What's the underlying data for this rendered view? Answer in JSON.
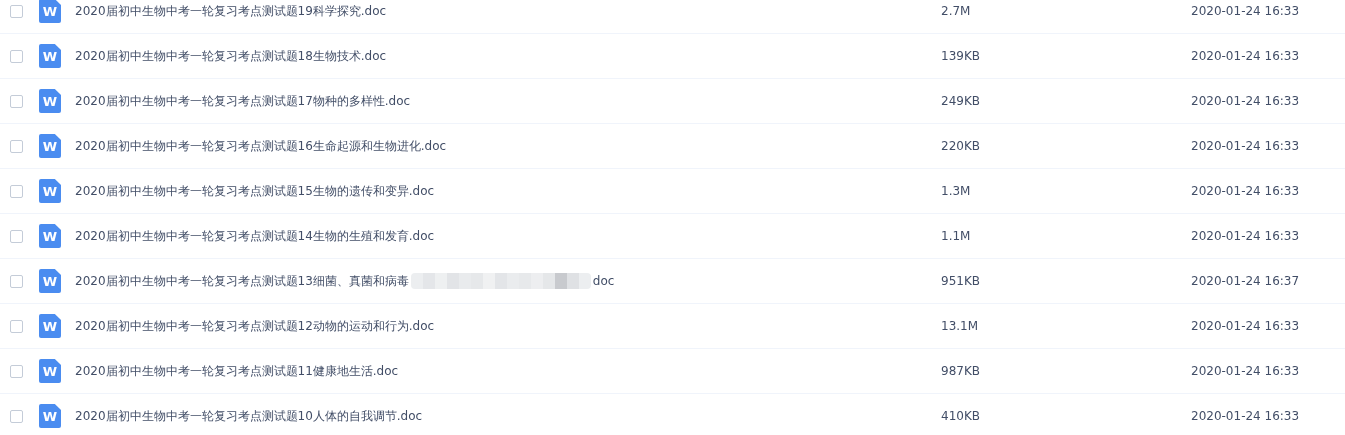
{
  "files": [
    {
      "checked": false,
      "icon_text": "W",
      "name": "2020届初中生物中考一轮复习考点测试题19科学探究.doc",
      "size": "2.7M",
      "modified": "2020-01-24 16:33"
    },
    {
      "checked": false,
      "icon_text": "W",
      "name": "2020届初中生物中考一轮复习考点测试题18生物技术.doc",
      "size": "139KB",
      "modified": "2020-01-24 16:33"
    },
    {
      "checked": false,
      "icon_text": "W",
      "name": "2020届初中生物中考一轮复习考点测试题17物种的多样性.doc",
      "size": "249KB",
      "modified": "2020-01-24 16:33"
    },
    {
      "checked": false,
      "icon_text": "W",
      "name": "2020届初中生物中考一轮复习考点测试题16生命起源和生物进化.doc",
      "size": "220KB",
      "modified": "2020-01-24 16:33"
    },
    {
      "checked": false,
      "icon_text": "W",
      "name": "2020届初中生物中考一轮复习考点测试题15生物的遗传和变异.doc",
      "size": "1.3M",
      "modified": "2020-01-24 16:33"
    },
    {
      "checked": false,
      "icon_text": "W",
      "name": "2020届初中生物中考一轮复习考点测试题14生物的生殖和发育.doc",
      "size": "1.1M",
      "modified": "2020-01-24 16:33"
    },
    {
      "checked": false,
      "icon_text": "W",
      "name": "2020届初中生物中考一轮复习考点测试题13细菌、真菌和病毒",
      "redacted": true,
      "name_tail": "doc",
      "size": "951KB",
      "modified": "2020-01-24 16:37"
    },
    {
      "checked": false,
      "icon_text": "W",
      "name": "2020届初中生物中考一轮复习考点测试题12动物的运动和行为.doc",
      "size": "13.1M",
      "modified": "2020-01-24 16:33"
    },
    {
      "checked": false,
      "icon_text": "W",
      "name": "2020届初中生物中考一轮复习考点测试题11健康地生活.doc",
      "size": "987KB",
      "modified": "2020-01-24 16:33"
    },
    {
      "checked": false,
      "icon_text": "W",
      "name": "2020届初中生物中考一轮复习考点测试题10人体的自我调节.doc",
      "size": "410KB",
      "modified": "2020-01-24 16:33"
    }
  ]
}
